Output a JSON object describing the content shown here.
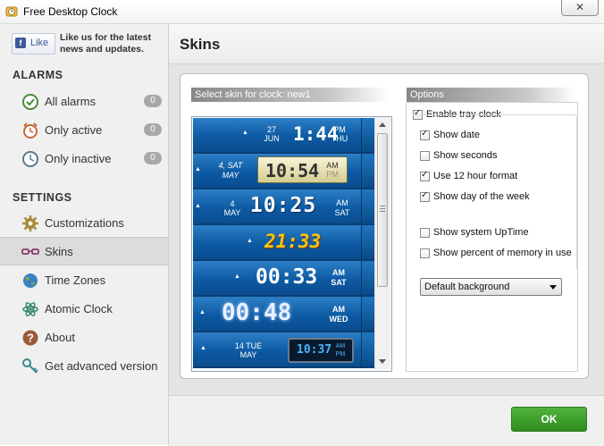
{
  "window": {
    "title": "Free Desktop Clock",
    "close_glyph": "✕"
  },
  "facebook": {
    "like_label": "Like",
    "promo": "Like us for the latest news and updates."
  },
  "sidebar": {
    "alarms_heading": "ALARMS",
    "settings_heading": "SETTINGS",
    "alarm_items": [
      {
        "label": "All alarms",
        "count": "0",
        "icon": "clock-check-icon"
      },
      {
        "label": "Only active",
        "count": "0",
        "icon": "alarm-clock-icon"
      },
      {
        "label": "Only inactive",
        "count": "0",
        "icon": "clock-icon"
      }
    ],
    "settings_items": [
      {
        "label": "Customizations",
        "icon": "gear-icon"
      },
      {
        "label": "Skins",
        "icon": "glasses-icon",
        "active": true
      },
      {
        "label": "Time Zones",
        "icon": "globe-icon"
      },
      {
        "label": "Atomic Clock",
        "icon": "atom-icon"
      },
      {
        "label": "About",
        "icon": "question-icon"
      },
      {
        "label": "Get advanced version",
        "icon": "key-icon"
      }
    ]
  },
  "header": {
    "title": "Skins"
  },
  "skins": {
    "label": "Select skin for clock: new1",
    "items": [
      {
        "date_top": "27",
        "date_bottom": "JUN",
        "time": "1:44",
        "ampm": "PM",
        "day": "THU"
      },
      {
        "date_top": "4, SAT",
        "date_bottom": "MAY",
        "time": "10:54",
        "ampm": "AM",
        "day": "PM"
      },
      {
        "date_top": "4",
        "date_bottom": "MAY",
        "time": "10:25",
        "ampm": "AM",
        "day": "SAT"
      },
      {
        "time": "21:33"
      },
      {
        "time": "00:33",
        "ampm": "AM",
        "day": "SAT"
      },
      {
        "time": "00:48",
        "ampm": "AM",
        "day": "WED"
      },
      {
        "date_top": "14 TUE",
        "date_bottom": "MAY",
        "time": "10:37",
        "ampm": "AM",
        "day": "PM"
      }
    ]
  },
  "options": {
    "label": "Options",
    "enable_tray": {
      "label": "Enable tray clock",
      "checked": true
    },
    "items": [
      {
        "label": "Show date",
        "checked": true
      },
      {
        "label": "Show seconds",
        "checked": false
      },
      {
        "label": "Use 12 hour format",
        "checked": true
      },
      {
        "label": "Show day of the week",
        "checked": true
      },
      {
        "label": "Show system UpTime",
        "checked": false
      },
      {
        "label": "Show percent of memory in use",
        "checked": false
      }
    ],
    "background_select": "Default background"
  },
  "footer": {
    "ok_label": "OK"
  },
  "colors": {
    "ok_green": "#3ea12b",
    "skin_blue": "#0d5aa3",
    "fb_blue": "#3b5998"
  }
}
